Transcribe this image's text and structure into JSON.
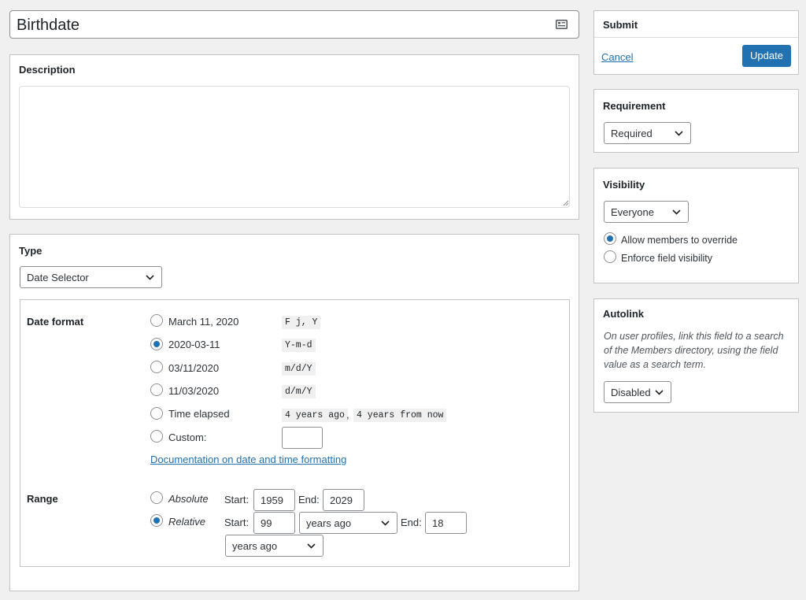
{
  "field": {
    "title_value": "Birthdate",
    "title_icon": "id-card-icon"
  },
  "description": {
    "heading": "Description",
    "value": ""
  },
  "type": {
    "heading": "Type",
    "selected": "Date Selector",
    "date_format": {
      "label": "Date format",
      "options": [
        {
          "label": "March 11, 2020",
          "code": "F j, Y",
          "checked": false
        },
        {
          "label": "2020-03-11",
          "code": "Y-m-d",
          "checked": true
        },
        {
          "label": "03/11/2020",
          "code": "m/d/Y",
          "checked": false
        },
        {
          "label": "11/03/2020",
          "code": "d/m/Y",
          "checked": false
        },
        {
          "label": "Time elapsed",
          "code": "4 years ago",
          "code2": "4 years from now",
          "separator": ",",
          "checked": false
        },
        {
          "label": "Custom:",
          "checked": false
        }
      ],
      "custom_value": "",
      "doc_link": "Documentation on date and time formatting"
    },
    "range": {
      "label": "Range",
      "absolute": {
        "label": "Absolute",
        "checked": false,
        "start_label": "Start:",
        "start": "1959",
        "end_label": "End:",
        "end": "2029"
      },
      "relative": {
        "label": "Relative",
        "checked": true,
        "start_label": "Start:",
        "start": "99",
        "start_unit": "years ago",
        "end_label": "End:",
        "end": "18",
        "end_unit": "years ago"
      }
    }
  },
  "submit": {
    "heading": "Submit",
    "cancel": "Cancel",
    "update": "Update"
  },
  "requirement": {
    "heading": "Requirement",
    "selected": "Required"
  },
  "visibility": {
    "heading": "Visibility",
    "selected": "Everyone",
    "options": [
      {
        "label": "Allow members to override",
        "checked": true
      },
      {
        "label": "Enforce field visibility",
        "checked": false
      }
    ]
  },
  "autolink": {
    "heading": "Autolink",
    "description": "On user profiles, link this field to a search of the Members directory, using the field value as a search term.",
    "selected": "Disabled"
  },
  "colors": {
    "accent": "#2271b1",
    "background": "#f0f0f1",
    "border": "#c3c4c7"
  }
}
